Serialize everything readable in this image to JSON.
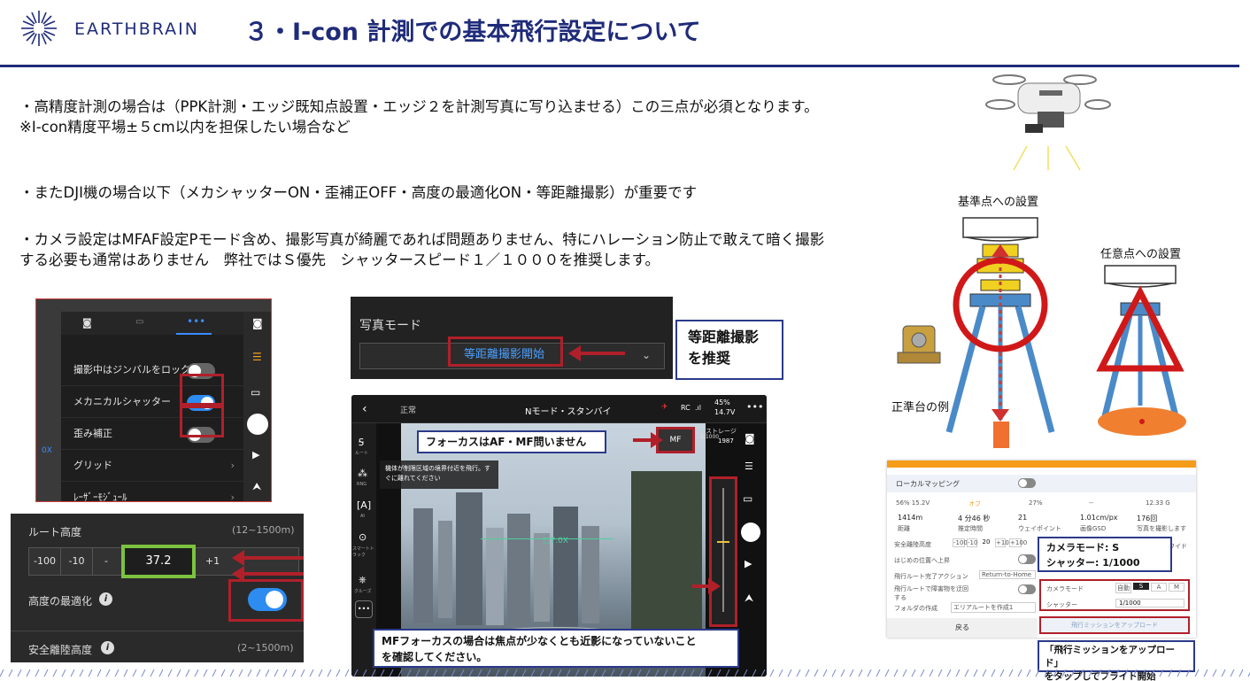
{
  "header": {
    "brand": "EARTHBRAIN",
    "title": "３・I-con 計測での基本飛行設定について",
    "colors": {
      "navy": "#1f2b7a",
      "red": "#b0202a"
    }
  },
  "body": {
    "line1": "・高精度計測の場合は（PPK計測・エッジ既知点設置・エッジ２を計測写真に写り込ませる）この三点が必須となります。",
    "line2": "※I-con精度平場±５cm以内を担保したい場合など",
    "line3": "・またDJI機の場合以下（メカシャッターON・歪補正OFF・高度の最適化ON・等距離撮影）が重要です",
    "line4": "・カメラ設定はMFAF設定Pモード含め、撮影写真が綺麗であれば問題ありません、特にハレーション防止で敢えて暗く撮影",
    "line5": "する必要も通常はありません　弊社ではＳ優先　シャッタースピード１／１０００を推奨します。"
  },
  "camera_menu": {
    "items": [
      "撮影中はジンバルをロック",
      "メカニカルシャッター",
      "歪み補正",
      "グリッド",
      "ﾚｰｻﾞｰﾓｼﾞｭｰﾙ"
    ],
    "states": [
      "off",
      "on",
      "off",
      "",
      ""
    ],
    "badge": "0X"
  },
  "route_panel": {
    "route_height_label": "ルート高度",
    "route_height_range": "(12~1500m)",
    "steps": [
      "-100",
      "-10",
      "-",
      "37.2",
      "+1",
      ""
    ],
    "optimize_label": "高度の最適化",
    "safe_height_label": "安全離陸高度",
    "safe_height_range": "(2~1500m)"
  },
  "photo_mode": {
    "label": "写真モード",
    "value": "等距離撮影開始",
    "callout": [
      "等距離撮影",
      "を推奨"
    ]
  },
  "flight_view": {
    "status_mode": "正常",
    "status_center": "Nモード・スタンバイ",
    "rc": "RC",
    "battery": "45%",
    "voltage": "14.7V",
    "storage_label": "ストレージ",
    "storage_value": "1987",
    "shutter": "1/1000",
    "mf": "MF",
    "warning": "機体が制限区域の境界付近を飛行。すぐに離れてください",
    "left_tools": [
      "ルート",
      "RNG",
      "AI",
      "スマートトラック",
      "クルーズ"
    ],
    "callout_top": "フォーカスはAF・MF問いません",
    "callout_bottom": [
      "MFフォーカスの場合は焦点が少なくとも近影になっていないこと",
      "を確認してください。"
    ]
  },
  "drone_diagram": {
    "label_base": "基準点への設置",
    "label_any": "任意点への設置",
    "label_stand": "正準台の例"
  },
  "mapping_panel": {
    "section": "ローカルマッピング",
    "stats_top": [
      "56% 15.2V",
      "オフ",
      "27%",
      "--",
      "12.33 G"
    ],
    "stats": [
      {
        "value": "1414m",
        "label": "距離"
      },
      {
        "value": "4 分46 秒",
        "label": "推定時間"
      },
      {
        "value": "21",
        "label": "ウェイポイント"
      },
      {
        "value": "1.01cm/px",
        "label": "画像GSD"
      },
      {
        "value": "176回",
        "label": "写真を撮影します"
      }
    ],
    "rows": [
      "安全離陸高度",
      "はじめの位置へ上昇",
      "飛行ルート完了アクション",
      "飛行ルートで障害物を迂回する",
      "フォルダの作成"
    ],
    "height_steps": [
      "-100",
      "-10",
      "20",
      "+10",
      "+100"
    ],
    "rth": "Return-to-Home",
    "folder": "エリアルートを作成1",
    "camera_mode_label": "カメラモード",
    "camera_modes": [
      "自動",
      "S",
      "A",
      "M"
    ],
    "shutter_label": "シャッター",
    "shutter_value": "1/1000",
    "back": "戻る",
    "upload": "飛行ミッションをアップロード",
    "right_cut": "写真",
    "right_cut2": "ワイド",
    "callout": [
      "カメラモード: S",
      "シャッター: 1/1000"
    ],
    "bottom_callout": [
      "「飛行ミッションをアップロード」",
      "をタップしてフライト開始"
    ]
  }
}
